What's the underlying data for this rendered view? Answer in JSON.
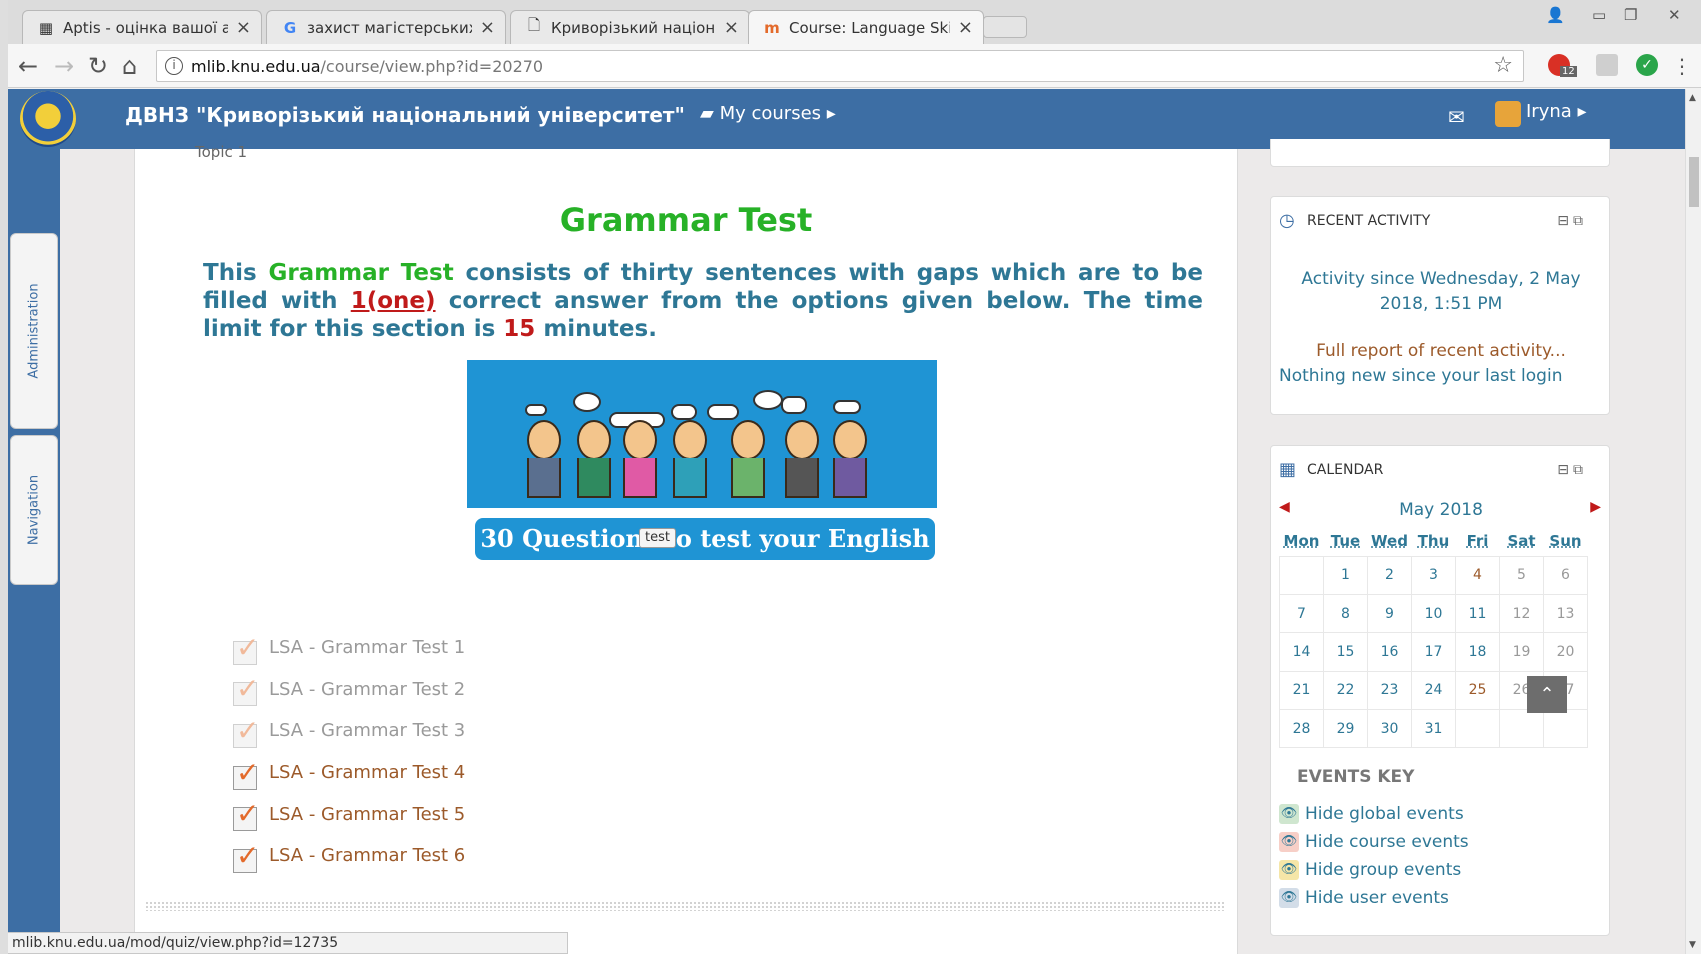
{
  "browser": {
    "tabs": [
      {
        "title": "Aptis - оцінка вашої анг",
        "icon": "grid-favicon-icon"
      },
      {
        "title": "захист магістерських ро",
        "icon": "google-favicon-icon"
      },
      {
        "title": "Криворізький національ",
        "icon": "page-favicon-icon"
      },
      {
        "title": "Course: Language Skills A",
        "icon": "moodle-favicon-icon"
      }
    ],
    "url_host": "mlib.knu.edu.ua",
    "url_path": "/course/view.php?id=20270",
    "ext_badge": "12",
    "status_url": "mlib.knu.edu.ua/mod/quiz/view.php?id=12735"
  },
  "header": {
    "site_name": "ДВНЗ \"Криворізький національний університет\"",
    "my_courses": "My courses",
    "user_name": "Iryna"
  },
  "dock": {
    "administration": "Administration",
    "navigation": "Navigation"
  },
  "main": {
    "cut_text": "Topic 1",
    "title": "Grammar Test",
    "intro": {
      "p1": "This ",
      "p2": "Grammar Test",
      "p3": " consists of thirty sentences with gaps which are to be filled with ",
      "p4": "1(one)",
      "p5": " correct answer from the options given below. The time limit for this section is ",
      "p6": "15",
      "p7": " minutes."
    },
    "banner_text": "30 Questions to test your English",
    "tooltip": "test",
    "activities": [
      {
        "label": "LSA - Grammar Test 1",
        "dim": true
      },
      {
        "label": "LSA - Grammar Test 2",
        "dim": true
      },
      {
        "label": "LSA - Grammar Test 3",
        "dim": true
      },
      {
        "label": "LSA - Grammar Test 4",
        "dim": false
      },
      {
        "label": "LSA - Grammar Test 5",
        "dim": false
      },
      {
        "label": "LSA - Grammar Test 6",
        "dim": false
      }
    ]
  },
  "recent_activity": {
    "title": "RECENT ACTIVITY",
    "since": "Activity since Wednesday, 2 May 2018, 1:51 PM",
    "full_report": "Full report of recent activity...",
    "nothing_new": "Nothing new since your last login"
  },
  "calendar": {
    "title": "CALENDAR",
    "month": "May 2018",
    "weekdays": [
      "Mon",
      "Tue",
      "Wed",
      "Thu",
      "Fri",
      "Sat",
      "Sun"
    ],
    "weeks": [
      [
        "",
        "1",
        "2",
        "3",
        "4",
        "5",
        "6"
      ],
      [
        "7",
        "8",
        "9",
        "10",
        "11",
        "12",
        "13"
      ],
      [
        "14",
        "15",
        "16",
        "17",
        "18",
        "19",
        "20"
      ],
      [
        "21",
        "22",
        "23",
        "24",
        "25",
        "26",
        "27"
      ],
      [
        "28",
        "29",
        "30",
        "31",
        "",
        "",
        ""
      ]
    ],
    "events_key_title": "EVENTS KEY",
    "events_key": [
      {
        "label": "Hide global events",
        "color": "#cfe6cf"
      },
      {
        "label": "Hide course events",
        "color": "#f7cfc7"
      },
      {
        "label": "Hide group events",
        "color": "#f5e6a8"
      },
      {
        "label": "Hide user events",
        "color": "#d3dde8"
      }
    ]
  },
  "colors": {
    "header_blue": "#3d6ea4",
    "title_green": "#27b127",
    "text_teal": "#2e7795",
    "accent_red": "#c01a1a"
  }
}
